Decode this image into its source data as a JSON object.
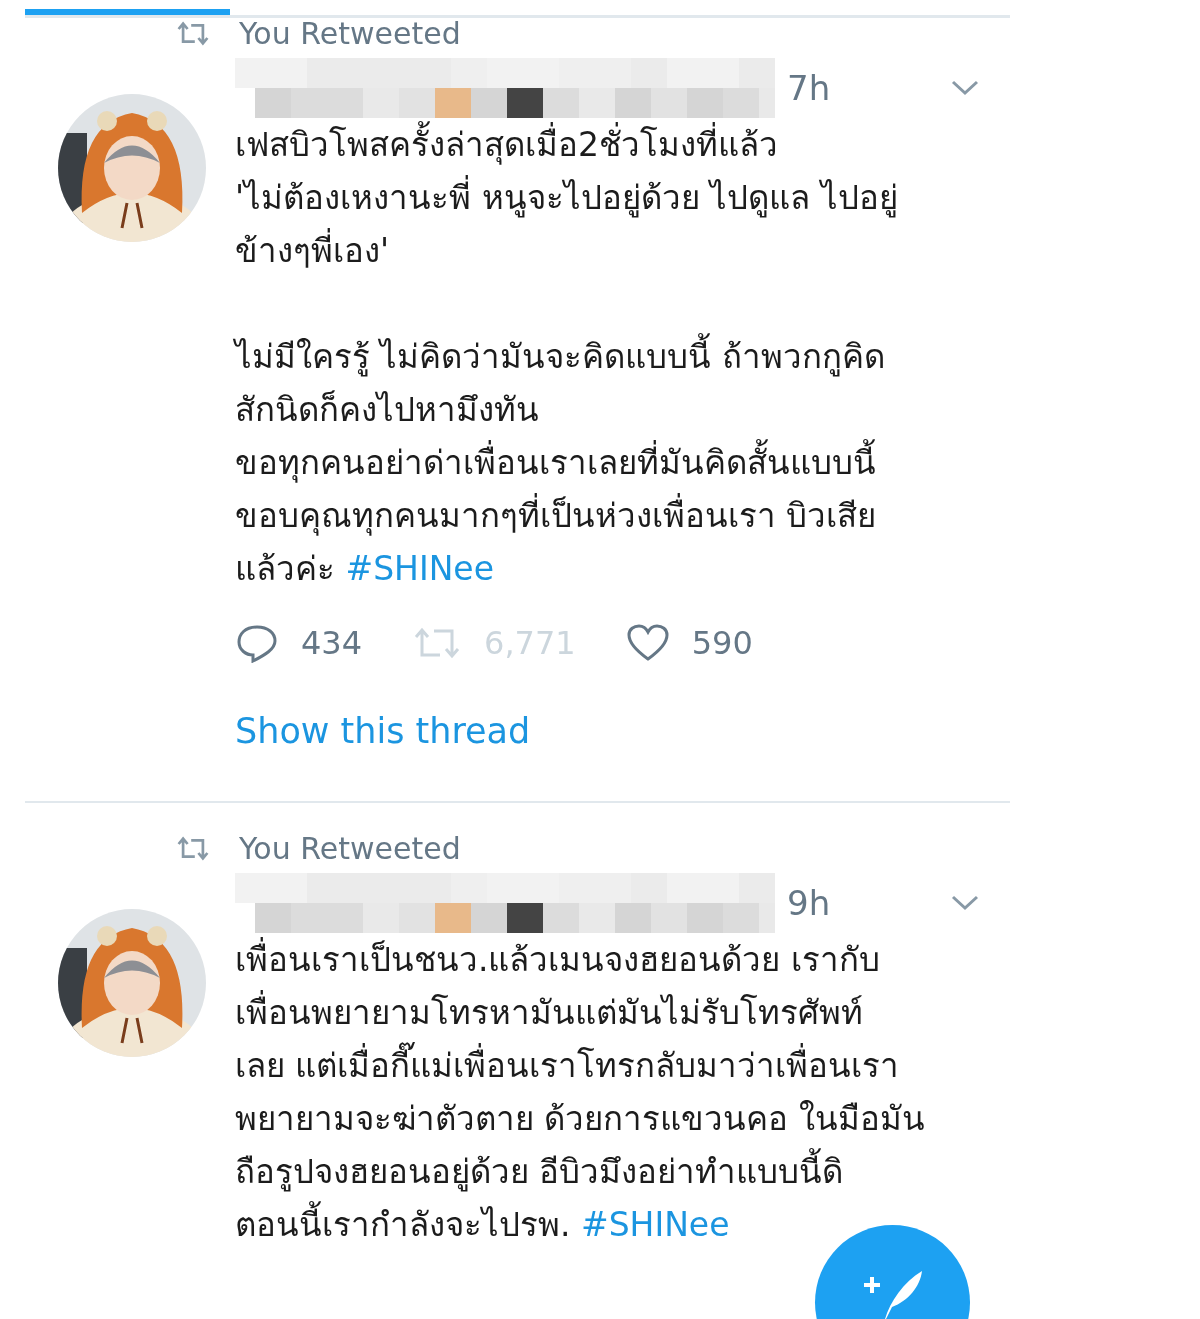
{
  "tweets": [
    {
      "retweet_label": "You Retweeted",
      "time": "7h",
      "paragraphs": [
        [
          {
            "text": "เฟสบิวโพสครั้งล่าสุดเมื่อ2ชั่วโมงที่แล้ว"
          },
          {
            "text": "'ไม่ต้องเหงานะพี่ หนูจะไปอยู่ด้วย ไปดูแล ไปอยู่"
          },
          {
            "text": "ข้างๆพี่เอง'"
          }
        ],
        [
          {
            "text": "ไม่มีใครรู้ ไม่คิดว่ามันจะคิดแบบนี้ ถ้าพวกกูคิด"
          },
          {
            "text": "สักนิดก็คงไปหามึงทัน"
          },
          {
            "text": "ขอทุกคนอย่าด่าเพื่อนเราเลยที่มันคิดสั้นแบบนี้"
          },
          {
            "text": "ขอบคุณทุกคนมากๆที่เป็นห่วงเพื่อนเรา บิวเสีย"
          },
          {
            "text": "แล้วค่ะ",
            "hashtag": "#SHINee"
          }
        ]
      ],
      "actions": [
        {
          "kind": "reply",
          "count": "434",
          "dimmed": false
        },
        {
          "kind": "retweet",
          "count": "6,771",
          "dimmed": true
        },
        {
          "kind": "like",
          "count": "590",
          "dimmed": false
        }
      ],
      "thread_link": "Show this thread"
    },
    {
      "retweet_label": "You Retweeted",
      "time": "9h",
      "paragraphs": [
        [
          {
            "text": "เพื่อนเราเป็นชนว.แล้วเมนจงฮยอนด้วย เรากับ"
          },
          {
            "text": "เพื่อนพยายามโทรหามันแต่มันไม่รับโทรศัพท์"
          },
          {
            "text": "เลย แต่เมื่อกี๊แม่เพื่อนเราโทรกลับมาว่าเพื่อนเรา"
          },
          {
            "text": "พยายามจะฆ่าตัวตาย ด้วยการแขวนคอ ในมือมัน"
          },
          {
            "text": "ถือรูปจงฮยอนอยู่ด้วย อีบิวมึงอย่าทำแบบนี้ดิ"
          },
          {
            "text": "ตอนนี้เรากำลังจะไปรพ.",
            "hashtag": "#SHINee"
          }
        ]
      ]
    }
  ]
}
